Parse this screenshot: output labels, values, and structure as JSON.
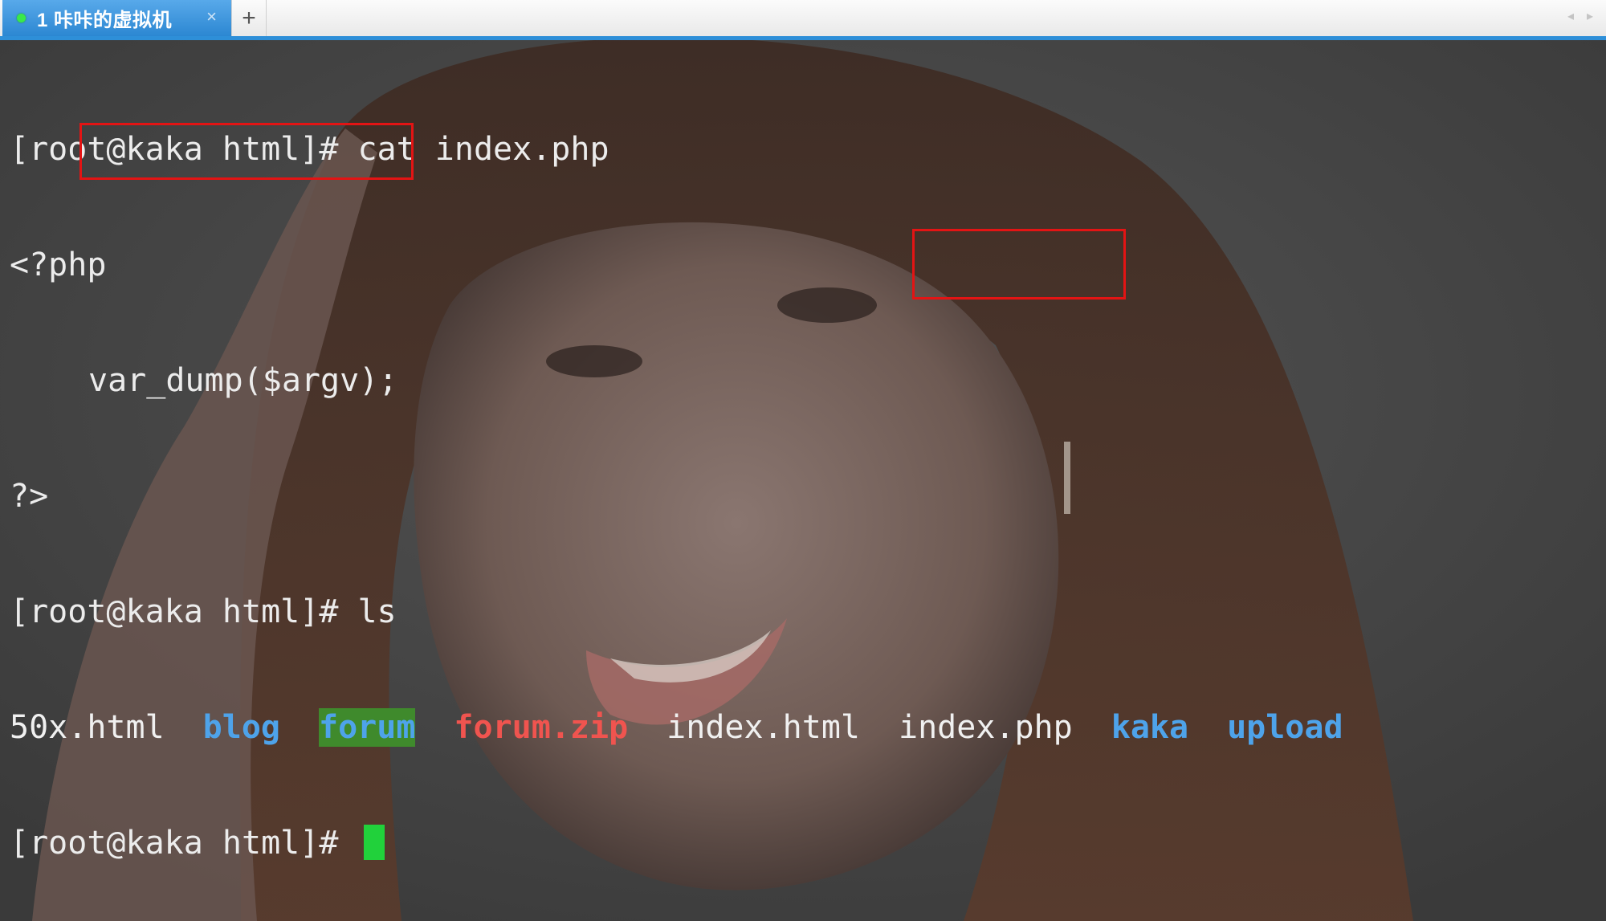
{
  "tab": {
    "number": "1",
    "title": "咔咔的虚拟机",
    "close_glyph": "×",
    "status_color": "#3ae84a"
  },
  "new_tab_glyph": "+",
  "scroll_arrows": {
    "left": "◂",
    "right": "▸"
  },
  "terminal": {
    "line1": "[root@kaka html]# cat index.php",
    "line2": "<?php",
    "line3": "var_dump($argv);",
    "line4": "?>",
    "line5": "[root@kaka html]# ls",
    "ls_items": [
      {
        "name": "50x.html",
        "kind": "plain"
      },
      {
        "name": "blog",
        "kind": "dir"
      },
      {
        "name": "forum",
        "kind": "sticky"
      },
      {
        "name": "forum.zip",
        "kind": "archive"
      },
      {
        "name": "index.html",
        "kind": "plain"
      },
      {
        "name": "index.php",
        "kind": "plain"
      },
      {
        "name": "kaka",
        "kind": "dir"
      },
      {
        "name": "upload",
        "kind": "dir"
      }
    ],
    "prompt": "[root@kaka html]# "
  },
  "colors": {
    "tab_active": "#2e8fd8",
    "highlight_box": "#e31414",
    "cursor": "#21d13b",
    "dir_text": "#4ea3ea",
    "archive_text": "#f0544f",
    "sticky_bg": "#3f8a2c"
  }
}
